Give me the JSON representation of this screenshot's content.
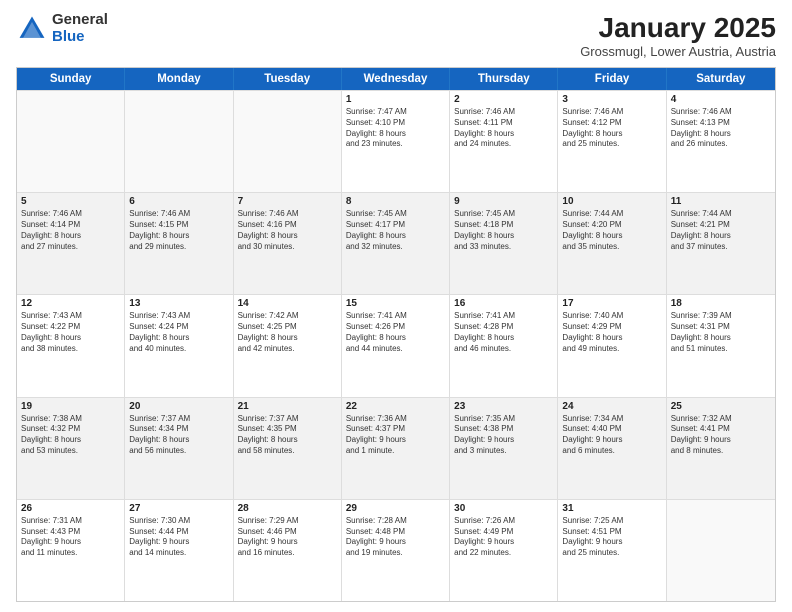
{
  "header": {
    "logo_general": "General",
    "logo_blue": "Blue",
    "main_title": "January 2025",
    "subtitle": "Grossmugl, Lower Austria, Austria"
  },
  "calendar": {
    "days_of_week": [
      "Sunday",
      "Monday",
      "Tuesday",
      "Wednesday",
      "Thursday",
      "Friday",
      "Saturday"
    ],
    "weeks": [
      [
        {
          "day": "",
          "info": ""
        },
        {
          "day": "",
          "info": ""
        },
        {
          "day": "",
          "info": ""
        },
        {
          "day": "1",
          "info": "Sunrise: 7:47 AM\nSunset: 4:10 PM\nDaylight: 8 hours\nand 23 minutes."
        },
        {
          "day": "2",
          "info": "Sunrise: 7:46 AM\nSunset: 4:11 PM\nDaylight: 8 hours\nand 24 minutes."
        },
        {
          "day": "3",
          "info": "Sunrise: 7:46 AM\nSunset: 4:12 PM\nDaylight: 8 hours\nand 25 minutes."
        },
        {
          "day": "4",
          "info": "Sunrise: 7:46 AM\nSunset: 4:13 PM\nDaylight: 8 hours\nand 26 minutes."
        }
      ],
      [
        {
          "day": "5",
          "info": "Sunrise: 7:46 AM\nSunset: 4:14 PM\nDaylight: 8 hours\nand 27 minutes."
        },
        {
          "day": "6",
          "info": "Sunrise: 7:46 AM\nSunset: 4:15 PM\nDaylight: 8 hours\nand 29 minutes."
        },
        {
          "day": "7",
          "info": "Sunrise: 7:46 AM\nSunset: 4:16 PM\nDaylight: 8 hours\nand 30 minutes."
        },
        {
          "day": "8",
          "info": "Sunrise: 7:45 AM\nSunset: 4:17 PM\nDaylight: 8 hours\nand 32 minutes."
        },
        {
          "day": "9",
          "info": "Sunrise: 7:45 AM\nSunset: 4:18 PM\nDaylight: 8 hours\nand 33 minutes."
        },
        {
          "day": "10",
          "info": "Sunrise: 7:44 AM\nSunset: 4:20 PM\nDaylight: 8 hours\nand 35 minutes."
        },
        {
          "day": "11",
          "info": "Sunrise: 7:44 AM\nSunset: 4:21 PM\nDaylight: 8 hours\nand 37 minutes."
        }
      ],
      [
        {
          "day": "12",
          "info": "Sunrise: 7:43 AM\nSunset: 4:22 PM\nDaylight: 8 hours\nand 38 minutes."
        },
        {
          "day": "13",
          "info": "Sunrise: 7:43 AM\nSunset: 4:24 PM\nDaylight: 8 hours\nand 40 minutes."
        },
        {
          "day": "14",
          "info": "Sunrise: 7:42 AM\nSunset: 4:25 PM\nDaylight: 8 hours\nand 42 minutes."
        },
        {
          "day": "15",
          "info": "Sunrise: 7:41 AM\nSunset: 4:26 PM\nDaylight: 8 hours\nand 44 minutes."
        },
        {
          "day": "16",
          "info": "Sunrise: 7:41 AM\nSunset: 4:28 PM\nDaylight: 8 hours\nand 46 minutes."
        },
        {
          "day": "17",
          "info": "Sunrise: 7:40 AM\nSunset: 4:29 PM\nDaylight: 8 hours\nand 49 minutes."
        },
        {
          "day": "18",
          "info": "Sunrise: 7:39 AM\nSunset: 4:31 PM\nDaylight: 8 hours\nand 51 minutes."
        }
      ],
      [
        {
          "day": "19",
          "info": "Sunrise: 7:38 AM\nSunset: 4:32 PM\nDaylight: 8 hours\nand 53 minutes."
        },
        {
          "day": "20",
          "info": "Sunrise: 7:37 AM\nSunset: 4:34 PM\nDaylight: 8 hours\nand 56 minutes."
        },
        {
          "day": "21",
          "info": "Sunrise: 7:37 AM\nSunset: 4:35 PM\nDaylight: 8 hours\nand 58 minutes."
        },
        {
          "day": "22",
          "info": "Sunrise: 7:36 AM\nSunset: 4:37 PM\nDaylight: 9 hours\nand 1 minute."
        },
        {
          "day": "23",
          "info": "Sunrise: 7:35 AM\nSunset: 4:38 PM\nDaylight: 9 hours\nand 3 minutes."
        },
        {
          "day": "24",
          "info": "Sunrise: 7:34 AM\nSunset: 4:40 PM\nDaylight: 9 hours\nand 6 minutes."
        },
        {
          "day": "25",
          "info": "Sunrise: 7:32 AM\nSunset: 4:41 PM\nDaylight: 9 hours\nand 8 minutes."
        }
      ],
      [
        {
          "day": "26",
          "info": "Sunrise: 7:31 AM\nSunset: 4:43 PM\nDaylight: 9 hours\nand 11 minutes."
        },
        {
          "day": "27",
          "info": "Sunrise: 7:30 AM\nSunset: 4:44 PM\nDaylight: 9 hours\nand 14 minutes."
        },
        {
          "day": "28",
          "info": "Sunrise: 7:29 AM\nSunset: 4:46 PM\nDaylight: 9 hours\nand 16 minutes."
        },
        {
          "day": "29",
          "info": "Sunrise: 7:28 AM\nSunset: 4:48 PM\nDaylight: 9 hours\nand 19 minutes."
        },
        {
          "day": "30",
          "info": "Sunrise: 7:26 AM\nSunset: 4:49 PM\nDaylight: 9 hours\nand 22 minutes."
        },
        {
          "day": "31",
          "info": "Sunrise: 7:25 AM\nSunset: 4:51 PM\nDaylight: 9 hours\nand 25 minutes."
        },
        {
          "day": "",
          "info": ""
        }
      ]
    ]
  }
}
